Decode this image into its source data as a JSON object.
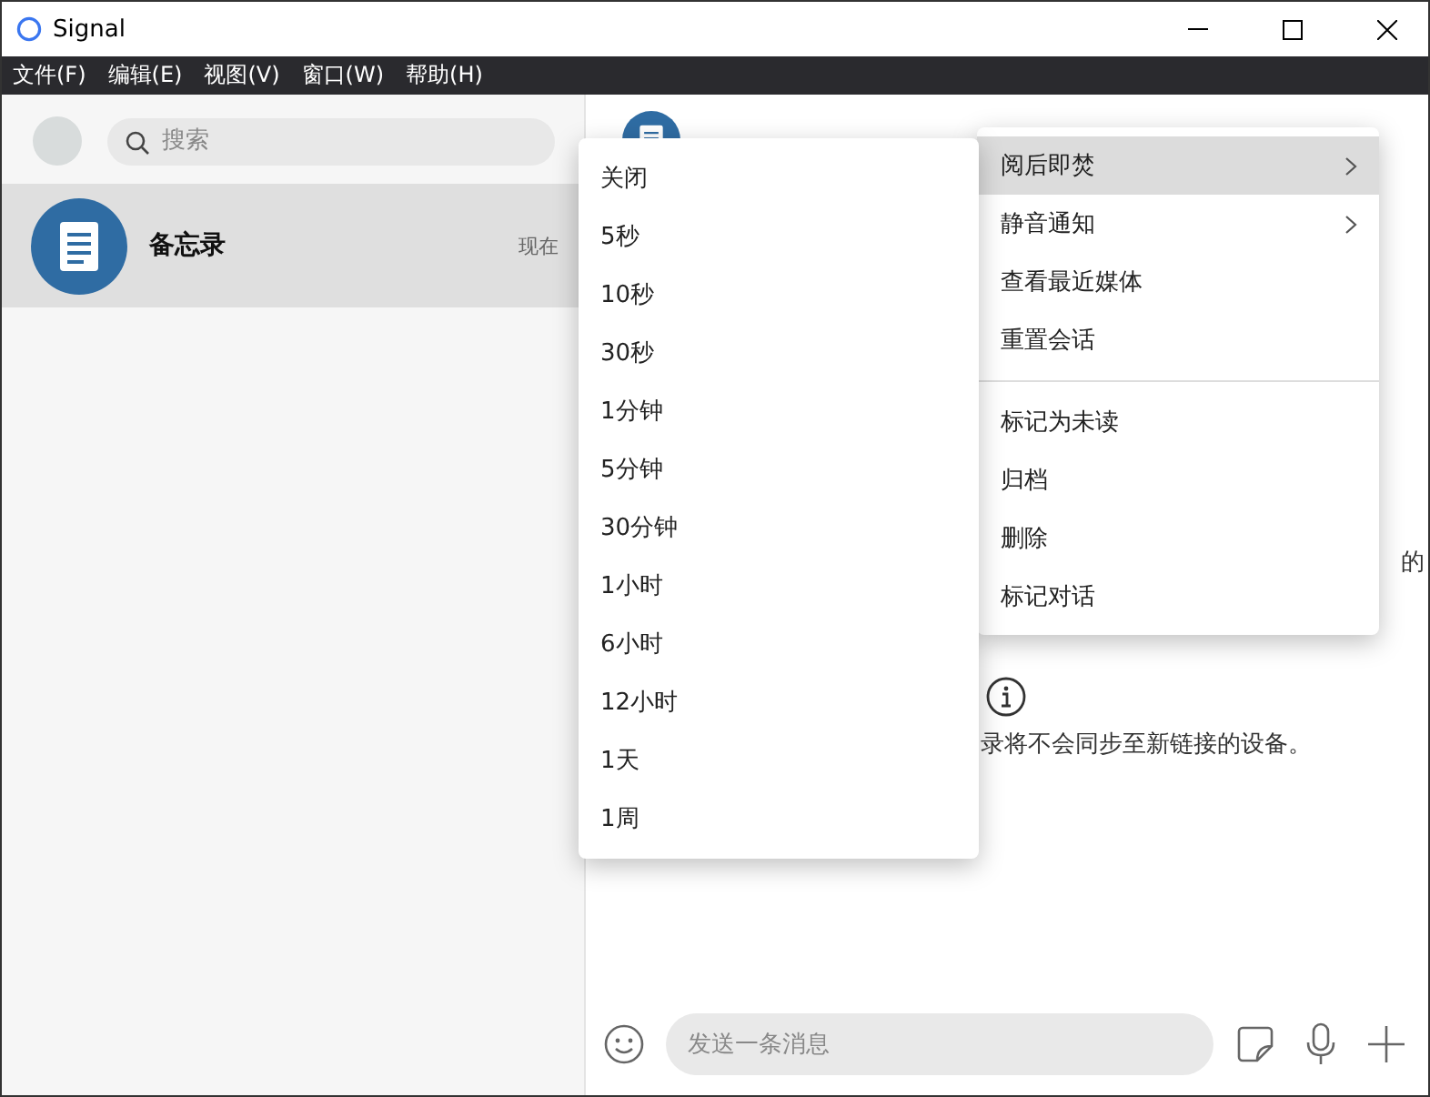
{
  "window": {
    "title": "Signal"
  },
  "menu_bar": [
    "文件(F)",
    "编辑(E)",
    "视图(V)",
    "窗口(W)",
    "帮助(H)"
  ],
  "search": {
    "placeholder": "搜索"
  },
  "conversations": [
    {
      "name": "备忘录",
      "time": "现在",
      "selected": true
    }
  ],
  "notice": {
    "fragment_right": "的",
    "text": "录将不会同步至新链接的设备。"
  },
  "composer": {
    "placeholder": "发送一条消息"
  },
  "context_menu": {
    "groups": [
      [
        {
          "label": "阅后即焚",
          "has_submenu": true,
          "selected": true
        },
        {
          "label": "静音通知",
          "has_submenu": true,
          "selected": false
        },
        {
          "label": "查看最近媒体",
          "has_submenu": false,
          "selected": false
        },
        {
          "label": "重置会话",
          "has_submenu": false,
          "selected": false
        }
      ],
      [
        {
          "label": "标记为未读",
          "has_submenu": false,
          "selected": false
        },
        {
          "label": "归档",
          "has_submenu": false,
          "selected": false
        },
        {
          "label": "删除",
          "has_submenu": false,
          "selected": false
        },
        {
          "label": "标记对话",
          "has_submenu": false,
          "selected": false
        }
      ]
    ]
  },
  "submenu": [
    "关闭",
    "5秒",
    "10秒",
    "30秒",
    "1分钟",
    "5分钟",
    "30分钟",
    "1小时",
    "6小时",
    "12小时",
    "1天",
    "1周"
  ]
}
